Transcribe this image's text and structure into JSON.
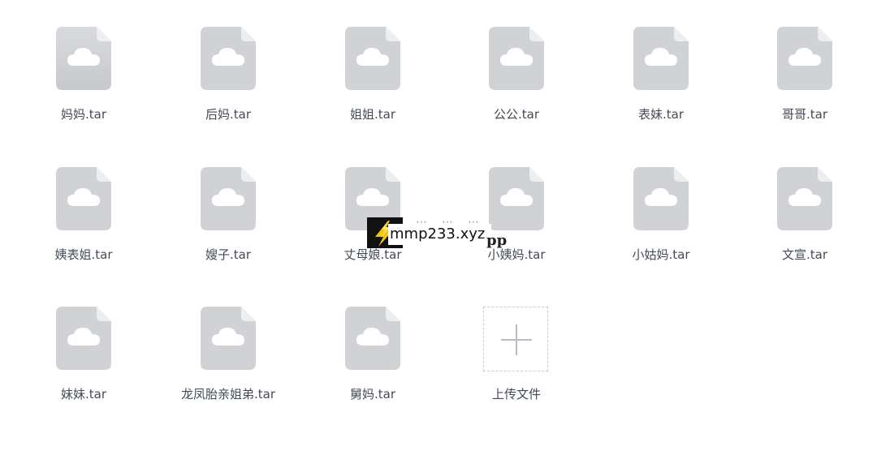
{
  "files": [
    {
      "name": "妈妈.tar",
      "icon": "cloud-file-icon"
    },
    {
      "name": "后妈.tar",
      "icon": "cloud-file-icon"
    },
    {
      "name": "姐姐.tar",
      "icon": "cloud-file-icon"
    },
    {
      "name": "公公.tar",
      "icon": "cloud-file-icon"
    },
    {
      "name": "表妹.tar",
      "icon": "cloud-file-icon"
    },
    {
      "name": "哥哥.tar",
      "icon": "cloud-file-icon"
    },
    {
      "name": "姨表姐.tar",
      "icon": "cloud-file-icon"
    },
    {
      "name": "嫂子.tar",
      "icon": "cloud-file-icon"
    },
    {
      "name": "丈母娘.tar",
      "icon": "cloud-file-icon"
    },
    {
      "name": "小姨妈.tar",
      "icon": "cloud-file-icon"
    },
    {
      "name": "小姑妈.tar",
      "icon": "cloud-file-icon"
    },
    {
      "name": "文宣.tar",
      "icon": "cloud-file-icon"
    },
    {
      "name": "妹妹.tar",
      "icon": "cloud-file-icon"
    },
    {
      "name": "龙凤胎亲姐弟.tar",
      "icon": "cloud-file-icon"
    },
    {
      "name": "舅妈.tar",
      "icon": "cloud-file-icon"
    }
  ],
  "upload": {
    "label": "上传文件",
    "icon": "plus-icon"
  },
  "watermark": {
    "text": "mmp233.xyz",
    "suffix": "pp",
    "icon": "lightning-logo-icon"
  },
  "colors": {
    "background": "#ffffff",
    "file_icon_top": "#d8dadd",
    "file_icon_bottom": "#c7c9cd",
    "cloud": "#ffffff",
    "label": "#444a55",
    "upload_border": "#c8ccd2",
    "plus": "#b9bcc2"
  }
}
